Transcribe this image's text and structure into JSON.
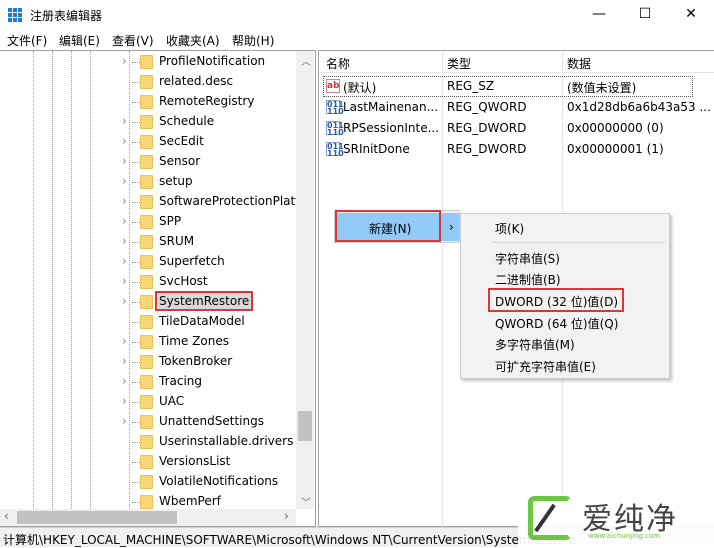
{
  "window": {
    "title": "注册表编辑器",
    "minimize": "—",
    "maximize": "☐",
    "close": "✕"
  },
  "menu": [
    "文件(F)",
    "编辑(E)",
    "查看(V)",
    "收藏夹(A)",
    "帮助(H)"
  ],
  "tree": {
    "items": [
      {
        "label": "ProfileNotification",
        "expandable": true
      },
      {
        "label": "related.desc",
        "expandable": false
      },
      {
        "label": "RemoteRegistry",
        "expandable": false
      },
      {
        "label": "Schedule",
        "expandable": true
      },
      {
        "label": "SecEdit",
        "expandable": true
      },
      {
        "label": "Sensor",
        "expandable": true
      },
      {
        "label": "setup",
        "expandable": true
      },
      {
        "label": "SoftwareProtectionPlatf",
        "expandable": true
      },
      {
        "label": "SPP",
        "expandable": true
      },
      {
        "label": "SRUM",
        "expandable": true
      },
      {
        "label": "Superfetch",
        "expandable": true
      },
      {
        "label": "SvcHost",
        "expandable": true
      },
      {
        "label": "SystemRestore",
        "expandable": true,
        "selected": true
      },
      {
        "label": "TileDataModel",
        "expandable": false
      },
      {
        "label": "Time Zones",
        "expandable": true
      },
      {
        "label": "TokenBroker",
        "expandable": true
      },
      {
        "label": "Tracing",
        "expandable": true
      },
      {
        "label": "UAC",
        "expandable": true
      },
      {
        "label": "UnattendSettings",
        "expandable": true
      },
      {
        "label": "Userinstallable.drivers",
        "expandable": false
      },
      {
        "label": "VersionsList",
        "expandable": false
      },
      {
        "label": "VolatileNotifications",
        "expandable": false
      },
      {
        "label": "WbemPerf",
        "expandable": false
      }
    ]
  },
  "values": {
    "headers": [
      "名称",
      "类型",
      "数据"
    ],
    "rows": [
      {
        "icon": "string-value-icon",
        "name": "(默认)",
        "type": "REG_SZ",
        "data": "(数值未设置)"
      },
      {
        "icon": "binary-value-icon",
        "name": "LastMainenan...",
        "type": "REG_QWORD",
        "data": "0x1d28db6a6b43a53 ..."
      },
      {
        "icon": "binary-value-icon",
        "name": "RPSessionInte...",
        "type": "REG_DWORD",
        "data": "0x00000000 (0)"
      },
      {
        "icon": "binary-value-icon",
        "name": "SRInitDone",
        "type": "REG_DWORD",
        "data": "0x00000001 (1)"
      }
    ]
  },
  "context_menu": {
    "new_label": "新建(N)",
    "arrow": "›"
  },
  "submenu": [
    "项(K)",
    "字符串值(S)",
    "二进制值(B)",
    "DWORD (32 位)值(D)",
    "QWORD (64 位)值(Q)",
    "多字符串值(M)",
    "可扩充字符串值(E)"
  ],
  "status": "计算机\\HKEY_LOCAL_MACHINE\\SOFTWARE\\Microsoft\\Windows NT\\CurrentVersion\\SystemRestore",
  "watermark": {
    "text": "爱纯净",
    "url": "www.aichunjing.com"
  },
  "colors": {
    "highlight": "#91c9f7",
    "annotation": "#d9373c",
    "folder": "#f8d676"
  }
}
